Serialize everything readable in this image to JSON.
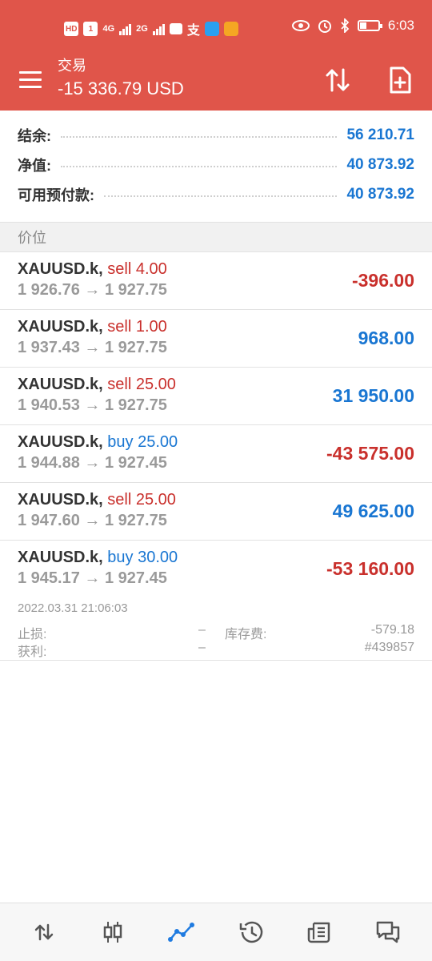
{
  "status_bar": {
    "hd": "HD",
    "sim": "1",
    "net1": "4G",
    "net2": "2G",
    "time": "6:03"
  },
  "app_bar": {
    "title": "交易",
    "balance": "-15 336.79 USD"
  },
  "summary": [
    {
      "label": "结余:",
      "value": "56 210.71"
    },
    {
      "label": "净值:",
      "value": "40 873.92"
    },
    {
      "label": "可用预付款:",
      "value": "40 873.92"
    }
  ],
  "section_header": "价位",
  "positions": [
    {
      "symbol": "XAUUSD.k,",
      "direction": "sell 4.00",
      "prices": "1 926.76 → 1 927.75",
      "pnl": "-396.00"
    },
    {
      "symbol": "XAUUSD.k,",
      "direction": "sell 1.00",
      "prices": "1 937.43 → 1 927.75",
      "pnl": "968.00"
    },
    {
      "symbol": "XAUUSD.k,",
      "direction": "sell 25.00",
      "prices": "1 940.53 → 1 927.75",
      "pnl": "31 950.00"
    },
    {
      "symbol": "XAUUSD.k,",
      "direction": "buy 25.00",
      "prices": "1 944.88 → 1 927.45",
      "pnl": "-43 575.00"
    },
    {
      "symbol": "XAUUSD.k,",
      "direction": "sell 25.00",
      "prices": "1 947.60 → 1 927.75",
      "pnl": "49 625.00"
    },
    {
      "symbol": "XAUUSD.k,",
      "direction": "buy 30.00",
      "prices": "1 945.17 → 1 927.45",
      "pnl": "-53 160.00",
      "details": {
        "time": "2022.03.31 21:06:03",
        "sl_label": "止损:",
        "sl_value": "–",
        "swap_label": "库存费:",
        "swap_value": "-579.18",
        "tp_label": "获利:",
        "tp_value": "–",
        "id": "#439857"
      }
    }
  ],
  "colors": {
    "accent": "#e0554a",
    "profit": "#1976d2",
    "loss": "#c9302c"
  },
  "bottom_nav": [
    "quotes-icon",
    "chart-icon",
    "trade-icon",
    "history-icon",
    "news-icon",
    "messages-icon"
  ]
}
